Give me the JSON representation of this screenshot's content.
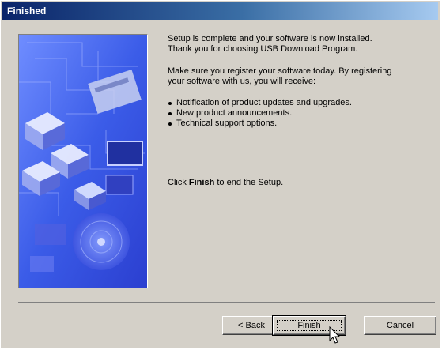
{
  "window": {
    "title": "Finished"
  },
  "content": {
    "line1": "Setup is complete and your software is now installed.",
    "line2": "Thank you for choosing USB Download Program.",
    "para2_line1": "Make sure you register your software today.  By registering",
    "para2_line2": "your software with us, you will receive:",
    "bullets": [
      "Notification of product updates and upgrades.",
      "New product announcements.",
      "Technical support options."
    ],
    "click_prefix": "Click",
    "click_bold": "Finish",
    "click_suffix": "to end the Setup."
  },
  "buttons": {
    "back_label": "< Back",
    "finish_label": "Finish",
    "cancel_label": "Cancel"
  },
  "colors": {
    "title_bar": "#0a246a",
    "dialog_face": "#d4d0c8",
    "banner_blue": "#2a4fd6"
  }
}
